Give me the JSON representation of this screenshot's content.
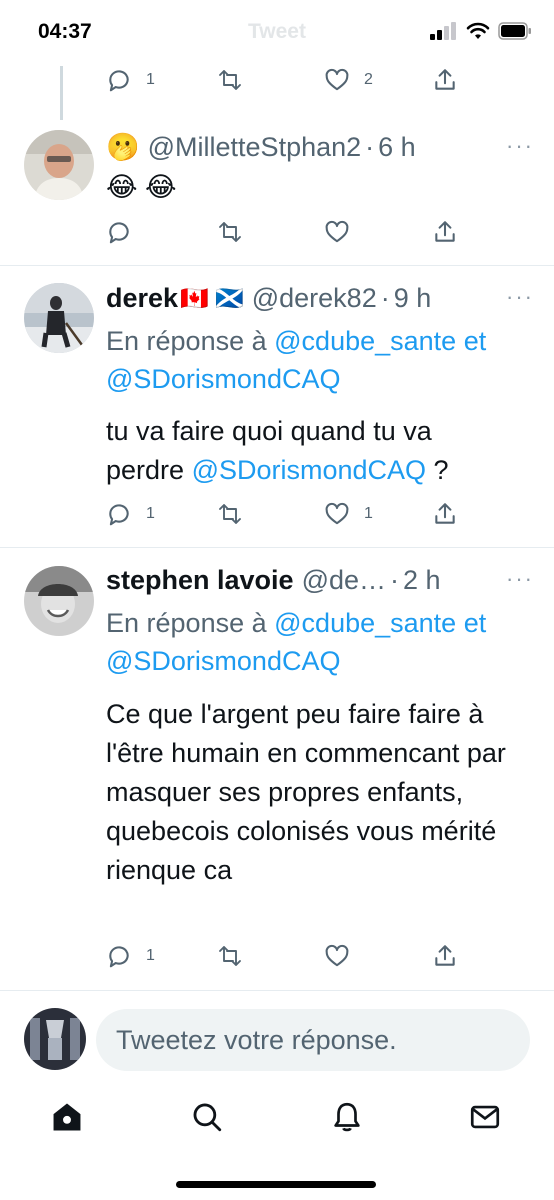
{
  "status_bar": {
    "time": "04:37",
    "title": "Tweet"
  },
  "top_actions": {
    "replies": "1",
    "likes": "2"
  },
  "tweets": [
    {
      "emoji_prefix": "🫢",
      "handle": "@MilletteStphan2",
      "separator": "·",
      "time": "6 h",
      "more": "···",
      "text": "😂 😂",
      "replies": "",
      "likes": ""
    },
    {
      "name": "derek",
      "flags": "🇨🇦 🏴󠁧󠁢󠁳󠁣󠁴󠁿",
      "handle": "@derek82",
      "separator": "·",
      "time": "9 h",
      "more": "···",
      "reply_prefix": "En réponse à",
      "mention1": "@cdube_sante",
      "conj": "et",
      "mention2": "@SDorismondCAQ",
      "text_part1": "tu va faire quoi quand tu va perdre",
      "text_mention": "@SDorismondCAQ",
      "text_part2": " ?",
      "replies": "1",
      "likes": "1"
    },
    {
      "name": "stephen lavoie",
      "handle": "@de…",
      "separator": "·",
      "time": "2 h",
      "more": "···",
      "reply_prefix": "En réponse à",
      "mention1": "@cdube_sante",
      "conj": "et",
      "mention2": "@SDorismondCAQ",
      "text": "Ce que l'argent peu faire faire à l'être humain en commencant par masquer ses propres enfants, quebecois colonisés vous mérité rienque ca",
      "replies": "1",
      "likes": ""
    }
  ],
  "composer": {
    "placeholder": "Tweetez votre réponse."
  },
  "colors": {
    "accent": "#1d9bf0",
    "secondary_text": "#536471",
    "divider": "#e6ecf0"
  },
  "tabbar_icons": [
    "home-icon",
    "search-icon",
    "notifications-icon",
    "messages-icon"
  ]
}
